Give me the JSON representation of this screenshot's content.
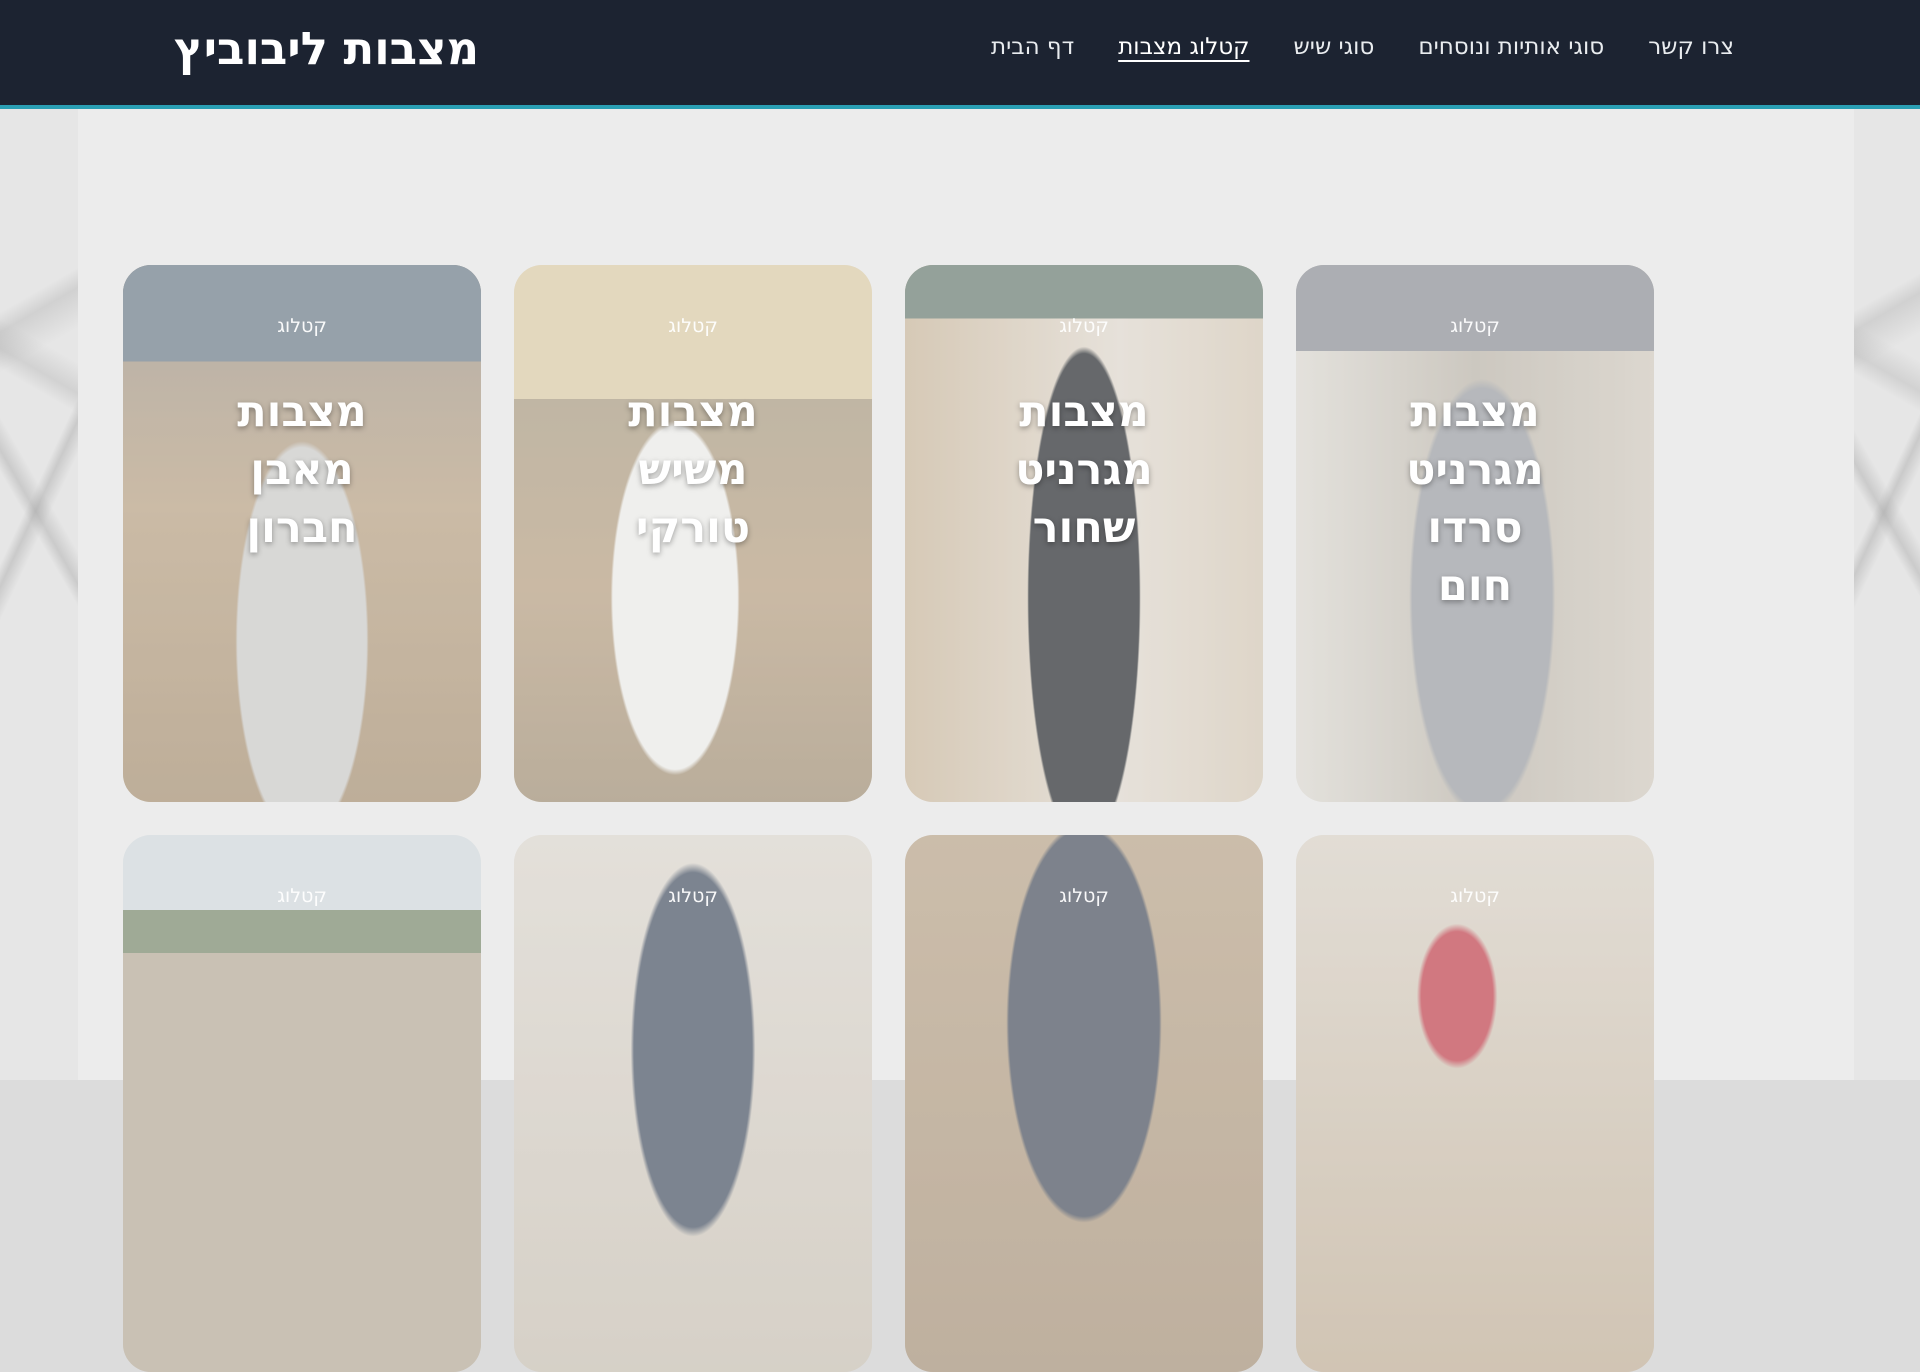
{
  "header": {
    "brand": "מצבות ליבוביץ",
    "nav": [
      {
        "label": "צרו קשר",
        "active": false
      },
      {
        "label": "סוגי אותיות ונוסחים",
        "active": false
      },
      {
        "label": "סוגי שיש",
        "active": false
      },
      {
        "label": "קטלוג מצבות",
        "active": true
      },
      {
        "label": "דף הבית",
        "active": false
      }
    ],
    "accent_color": "#2a9fb4",
    "background_color": "#1c2331"
  },
  "catalog": {
    "cards": [
      {
        "tag": "קטלוג",
        "title_lines": [
          "מצבות",
          "מגרניט",
          "סרדו",
          "חום"
        ]
      },
      {
        "tag": "קטלוג",
        "title_lines": [
          "מצבות",
          "מגרניט",
          "שחור"
        ]
      },
      {
        "tag": "קטלוג",
        "title_lines": [
          "מצבות",
          "משיש",
          "טורקי"
        ]
      },
      {
        "tag": "קטלוג",
        "title_lines": [
          "מצבות",
          "מאבן",
          "חברון"
        ]
      },
      {
        "tag": "קטלוג",
        "title_lines": []
      },
      {
        "tag": "קטלוג",
        "title_lines": []
      },
      {
        "tag": "קטלוג",
        "title_lines": []
      },
      {
        "tag": "קטלוג",
        "title_lines": []
      }
    ]
  }
}
